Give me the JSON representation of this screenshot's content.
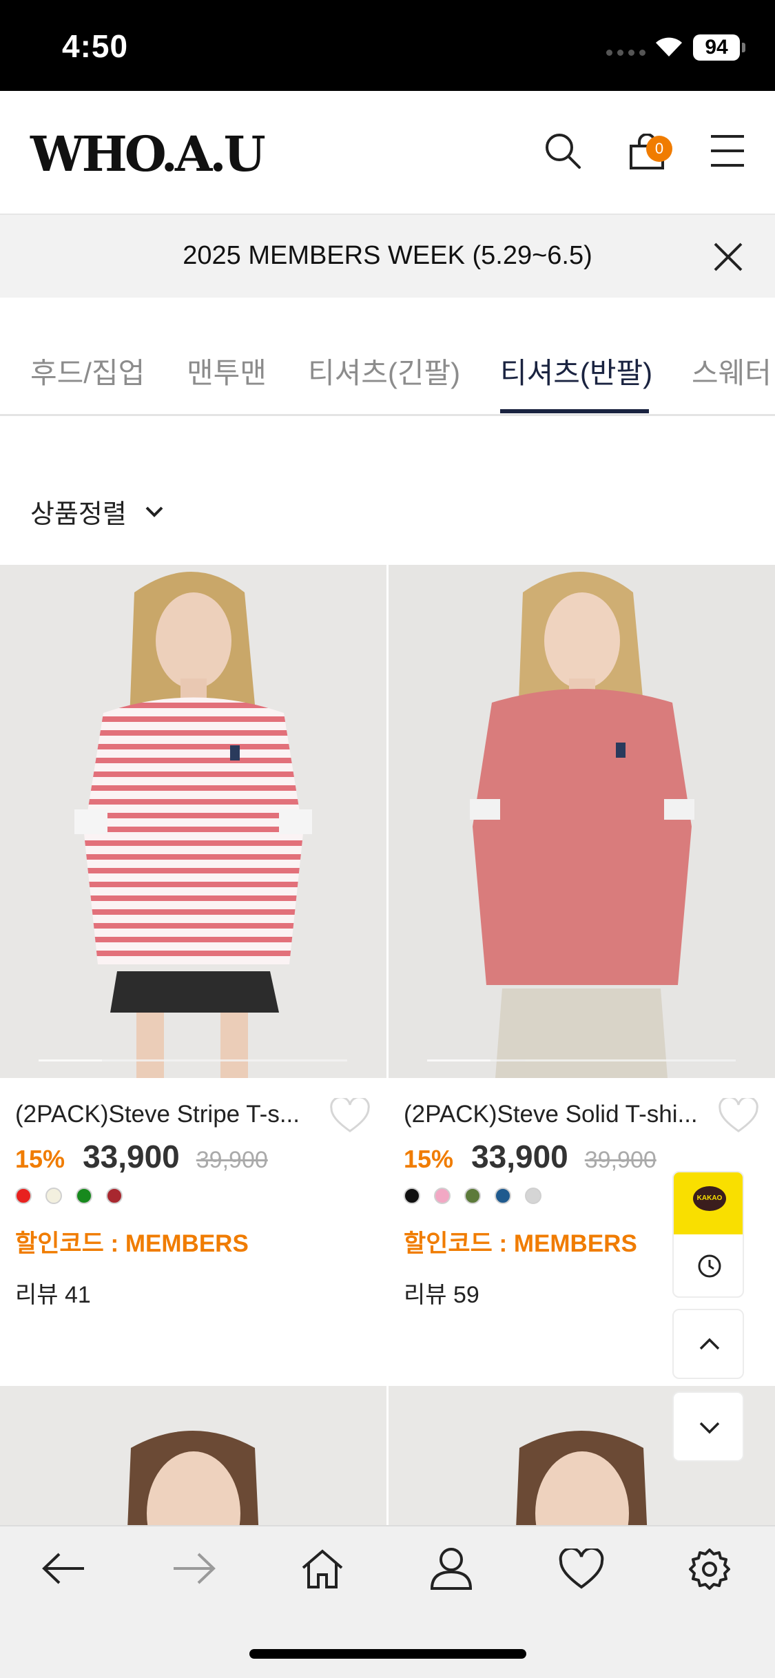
{
  "status_bar": {
    "time": "4:50",
    "battery": "94"
  },
  "header": {
    "logo": "WHO.A.U",
    "cart_count": "0"
  },
  "banner": {
    "text": "2025 MEMBERS WEEK (5.29~6.5)"
  },
  "tabs": [
    {
      "label": "후드/집업"
    },
    {
      "label": "맨투맨"
    },
    {
      "label": "티셔츠(긴팔)"
    },
    {
      "label": "티셔츠(반팔)",
      "active": true
    },
    {
      "label": "스웨터"
    }
  ],
  "sort": {
    "label": "상품정렬"
  },
  "products": [
    {
      "name": "(2PACK)Steve Stripe T-s...",
      "discount": "15%",
      "price": "33,900",
      "original_price": "39,900",
      "colors": [
        "#e8211f",
        "#f3f0df",
        "#17891d",
        "#a8272f"
      ],
      "discount_code": "할인코드 : MEMBERS",
      "review": "리뷰 41"
    },
    {
      "name": "(2PACK)Steve Solid T-shi...",
      "discount": "15%",
      "price": "33,900",
      "original_price": "39,900",
      "colors": [
        "#111111",
        "#f2a8c4",
        "#5c7a3a",
        "#1f5a8e",
        "#d5d5d5"
      ],
      "discount_code": "할인코드 : MEMBERS",
      "review": "리뷰 59"
    }
  ],
  "floating": {
    "kakao_label": "KAKAO"
  },
  "theme": {
    "accent": "#f07c00",
    "tab_active": "#1a2340",
    "kakao": "#f9df00"
  }
}
